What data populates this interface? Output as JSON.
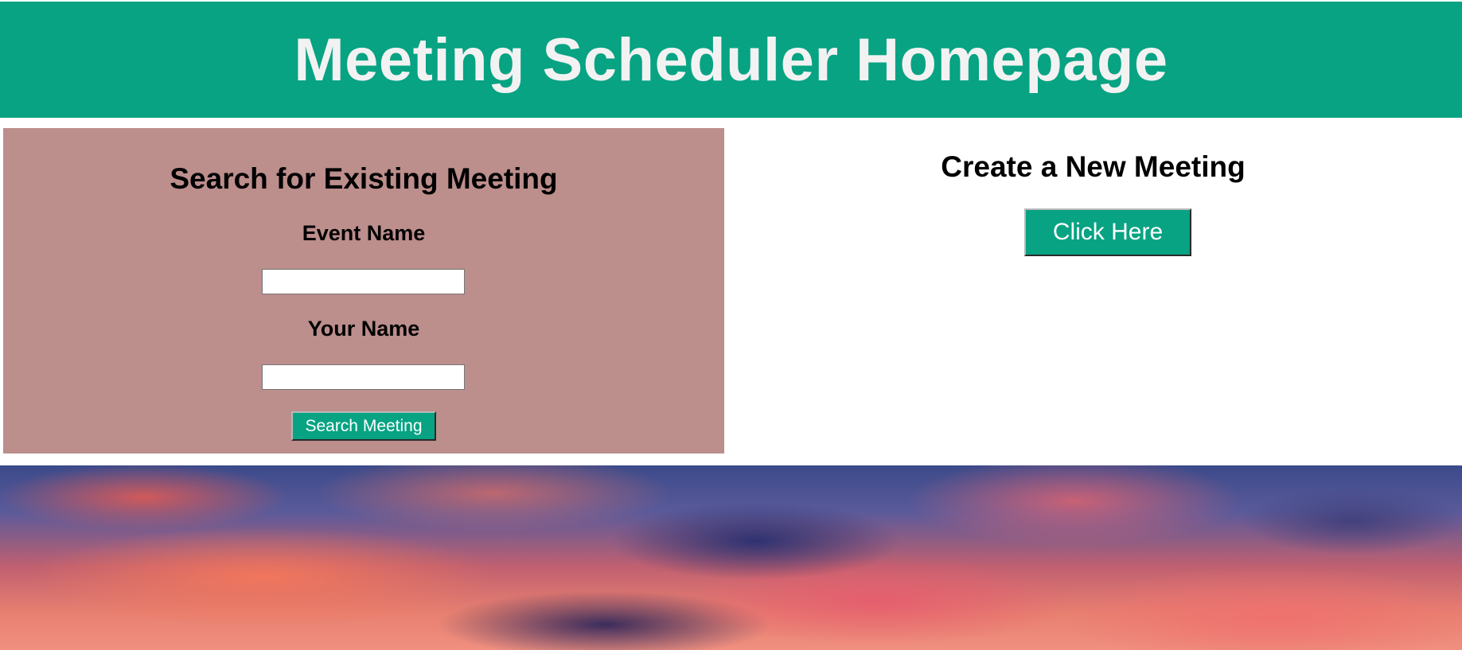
{
  "header": {
    "title": "Meeting Scheduler Homepage"
  },
  "search": {
    "heading": "Search for Existing Meeting",
    "event_name_label": "Event Name",
    "event_name_value": "",
    "your_name_label": "Your Name",
    "your_name_value": "",
    "button_label": "Search Meeting"
  },
  "create": {
    "heading": "Create a New Meeting",
    "button_label": "Click Here"
  },
  "colors": {
    "header_bg": "#07a383",
    "search_panel_bg": "#bc8e8c",
    "button_bg": "#07a383"
  }
}
